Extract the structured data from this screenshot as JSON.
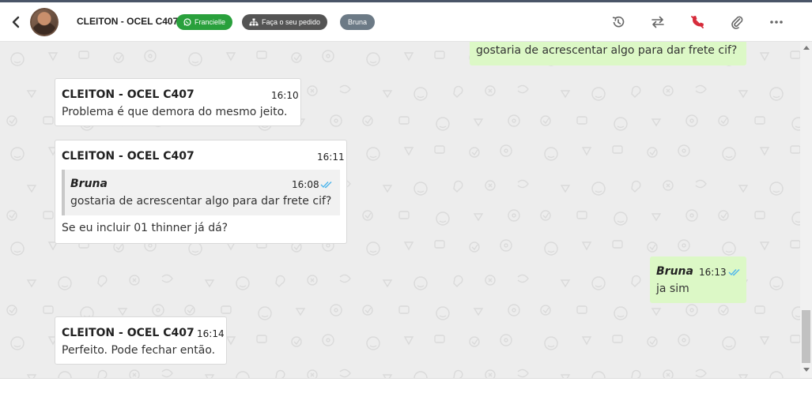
{
  "header": {
    "contact_name": "CLEITON - OCEL C407",
    "tags": [
      {
        "label": "Francielle",
        "color": "#29a03c",
        "icon": "whatsapp-icon"
      },
      {
        "label": "Faça o seu pedido",
        "color": "#545454",
        "icon": "sitemap-icon"
      },
      {
        "label": "Bruna",
        "color": "#6c7a86"
      }
    ],
    "actions": [
      "history-icon",
      "transfer-icon",
      "end-call-icon",
      "attach-icon",
      "more-icon"
    ]
  },
  "messages": [
    {
      "direction": "out",
      "text": "gostaria de acrescentar algo para dar frete cif?"
    },
    {
      "direction": "in",
      "sender": "CLEITON - OCEL C407",
      "time": "16:10",
      "text": "Problema é que demora do mesmo jeito."
    },
    {
      "direction": "in",
      "sender": "CLEITON - OCEL C407",
      "time": "16:11",
      "quote": {
        "sender": "Bruna",
        "time": "16:08",
        "text": "gostaria de acrescentar algo para dar frete cif?"
      },
      "text": "Se eu incluir 01 thinner já dá?"
    },
    {
      "direction": "out",
      "sender": "Bruna",
      "time": "16:13",
      "text": "ja sim"
    },
    {
      "direction": "in",
      "sender": "CLEITON - OCEL C407",
      "time": "16:14",
      "text": "Perfeito. Pode fechar então."
    }
  ],
  "colors": {
    "outgoing_bubble": "#dcf8c6",
    "incoming_bubble": "#ffffff",
    "chat_background": "#ededed",
    "read_ticks": "#4fb6ec"
  }
}
